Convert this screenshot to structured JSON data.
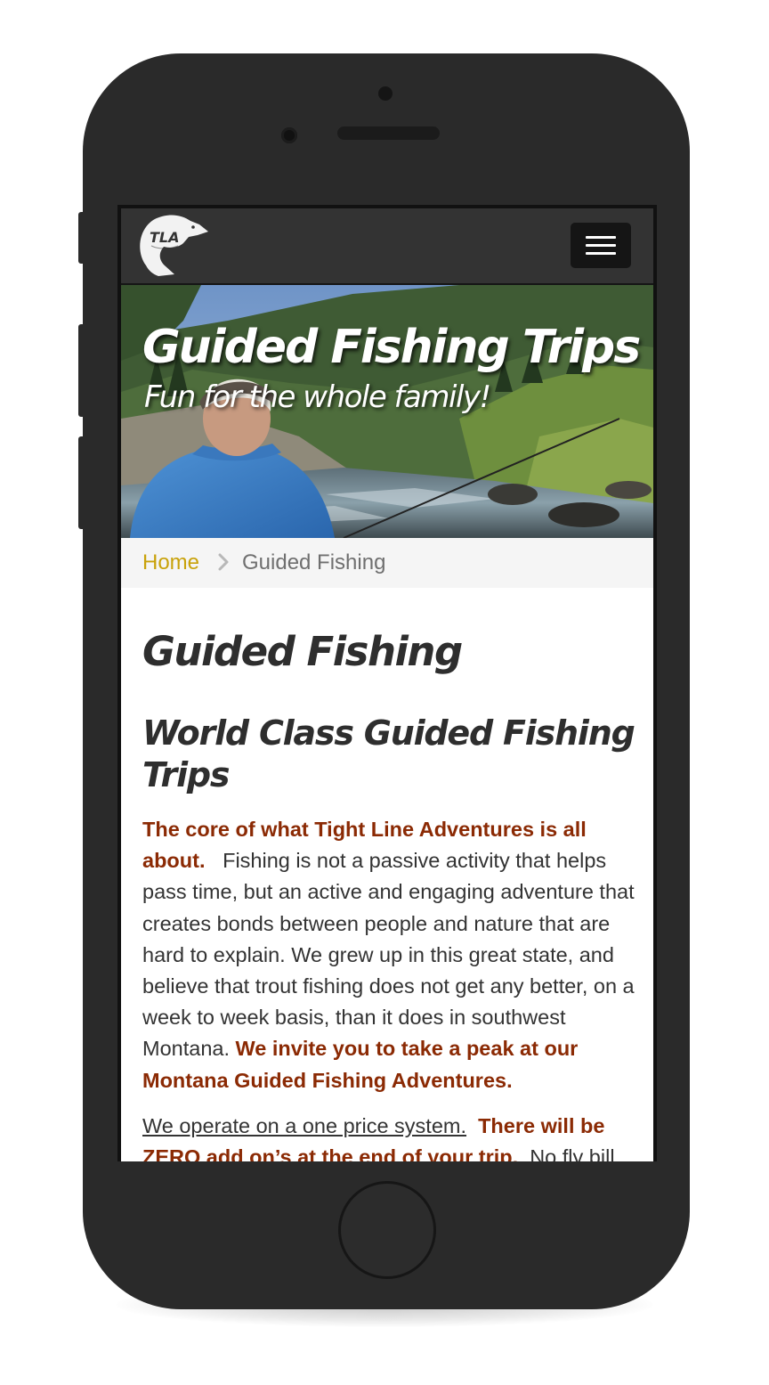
{
  "brand": {
    "logo_text": "TLA"
  },
  "hero": {
    "title": "Guided Fishing Trips",
    "subtitle": "Fun for the whole family!"
  },
  "breadcrumb": {
    "home": "Home",
    "current": "Guided Fishing"
  },
  "main": {
    "page_title": "Guided Fishing",
    "subtitle": "World Class Guided Fishing Trips",
    "para1": {
      "lead": "The core of what Tight Line Adventures is all about.",
      "body": "Fishing is not a passive activity that helps pass time, but an active and engaging adventure that creates bonds between people and nature that are hard to explain. We grew up in this great state, and believe that trout fishing does not get any better, on a week to week basis, than it does in southwest Montana.",
      "cta": "We invite you to take a peak at our Montana Guided Fishing Adventures."
    },
    "para2": {
      "underlined": "We operate on a one price system.",
      "highlight": "There will be ZERO add on’s at the end of your trip.",
      "body": "No fly bill"
    }
  },
  "colors": {
    "navbar": "#333333",
    "accent_link": "#c9a20a",
    "highlight_text": "#8b2a04",
    "phone_body": "#2a2a2a"
  },
  "icons": {
    "menu": "hamburger-icon",
    "breadcrumb_separator": "chevron-right-icon"
  }
}
